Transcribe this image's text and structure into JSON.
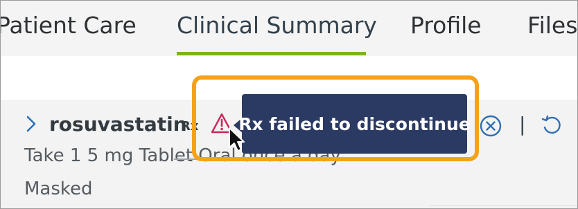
{
  "tabs": [
    {
      "label": "Patient Care"
    },
    {
      "label": "Clinical Summary",
      "active": true
    },
    {
      "label": "Profile"
    },
    {
      "label": "Files"
    }
  ],
  "medication": {
    "name": "rosuvastatin",
    "badge": "Rx",
    "sig": "Take 1 5 mg Tablet Oral once a day",
    "status": "Masked"
  },
  "tooltip": {
    "text": "Rx failed to discontinue"
  },
  "icons": {
    "expand": "chevron-right-icon",
    "warning": "warning-triangle-icon",
    "discontinue": "circle-x-icon",
    "undo": "undo-icon"
  },
  "separator": "|",
  "colors": {
    "tab_active_underline": "#7ab51d",
    "tooltip_bg": "#2b3a63",
    "highlight_border": "#f5a21b",
    "warning": "#d0245a",
    "action_icon": "#2f6fb3"
  }
}
